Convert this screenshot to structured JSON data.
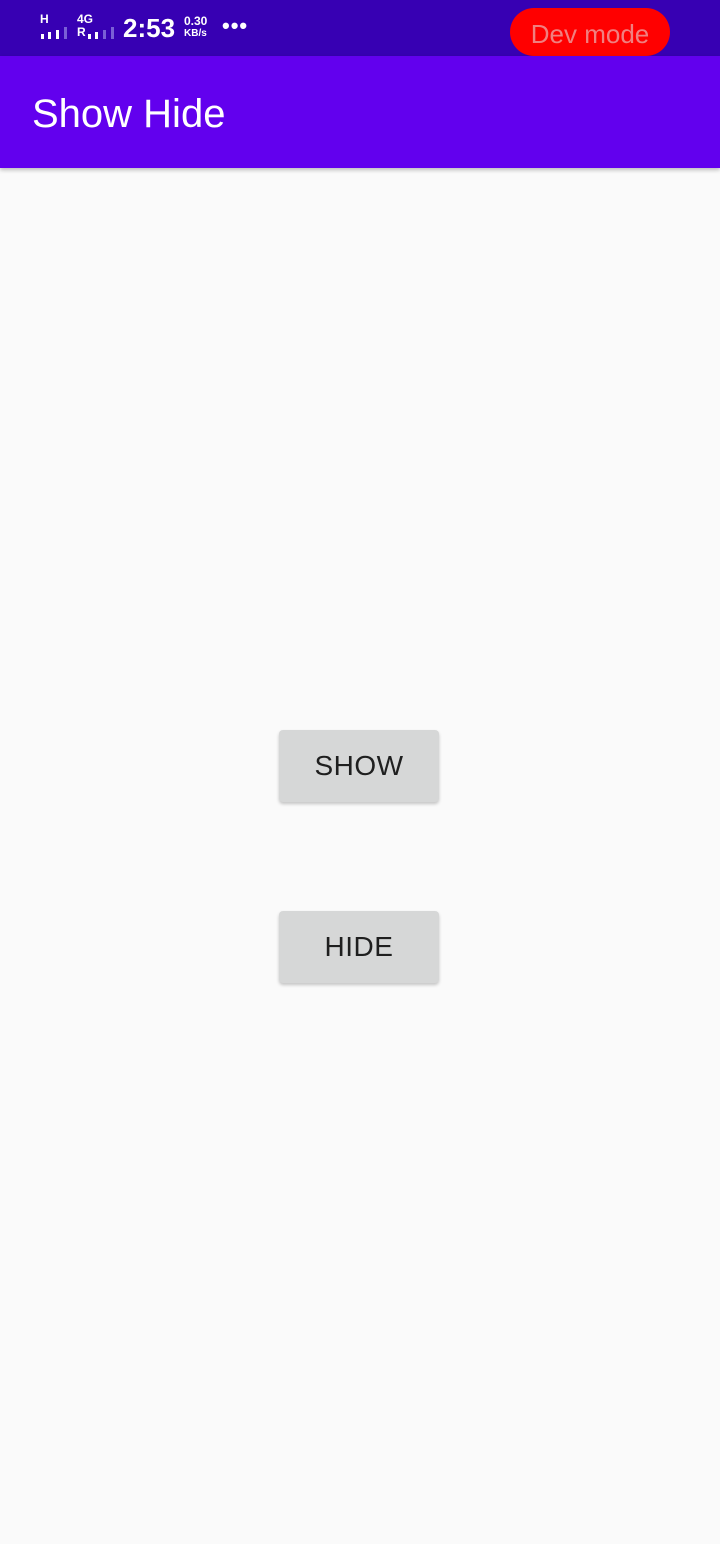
{
  "status_bar": {
    "network1_label": "H",
    "network2_label_top": "4G",
    "network2_label_bottom": "R",
    "time": "2:53",
    "speed_value": "0.30",
    "speed_unit": "KB/s",
    "more_indicator": "•••",
    "dev_mode_label": "Dev mode",
    "colors": {
      "background": "#3700b3",
      "dev_pill": "#ff0000"
    }
  },
  "app_bar": {
    "title": "Show Hide",
    "color": "#6200ee"
  },
  "buttons": {
    "show_label": "SHOW",
    "hide_label": "HIDE"
  }
}
